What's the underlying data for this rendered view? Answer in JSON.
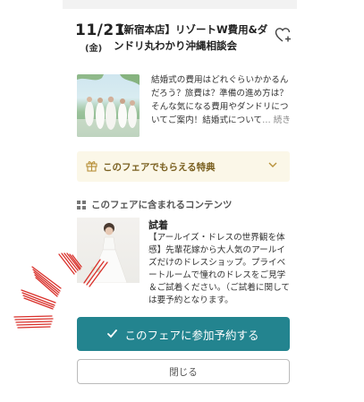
{
  "event": {
    "date": "11/21",
    "weekday": "(金)",
    "title": "【新宿本店】リゾートW費用&ダンドリ丸わかり沖縄相談会",
    "favorite_icon": "heart-plus-icon"
  },
  "summary": {
    "description": "結婚式の費用はどれぐらいかかるんだろう？旅費は？準備の進め方は？そんな気になる費用やダンドリについてご案内！結婚式について",
    "read_more": "… 続きを読む",
    "read_more_icon": "chevron-down-icon"
  },
  "benefit": {
    "label": "このフェアでもらえる特典",
    "icon": "gift-icon",
    "chevron_icon": "chevron-down-icon",
    "accent_color": "#7a6020",
    "background": "#fbf7e8"
  },
  "contents": {
    "heading": "このフェアに含まれるコンテンツ",
    "icon": "grid-icon",
    "item": {
      "title": "試着",
      "description": "【アールイズ・ドレスの世界観を体感】先輩花嫁から大人気のアールイズだけのドレスショップ。プライベートルームで憧れのドレスをご見学＆ご試着ください。（ご試着に関しては要予約となります。"
    }
  },
  "actions": {
    "reserve_label": "このフェアに参加予約する",
    "reserve_icon": "check-icon",
    "reserve_color": "#23848f",
    "close_label": "閉じる"
  }
}
